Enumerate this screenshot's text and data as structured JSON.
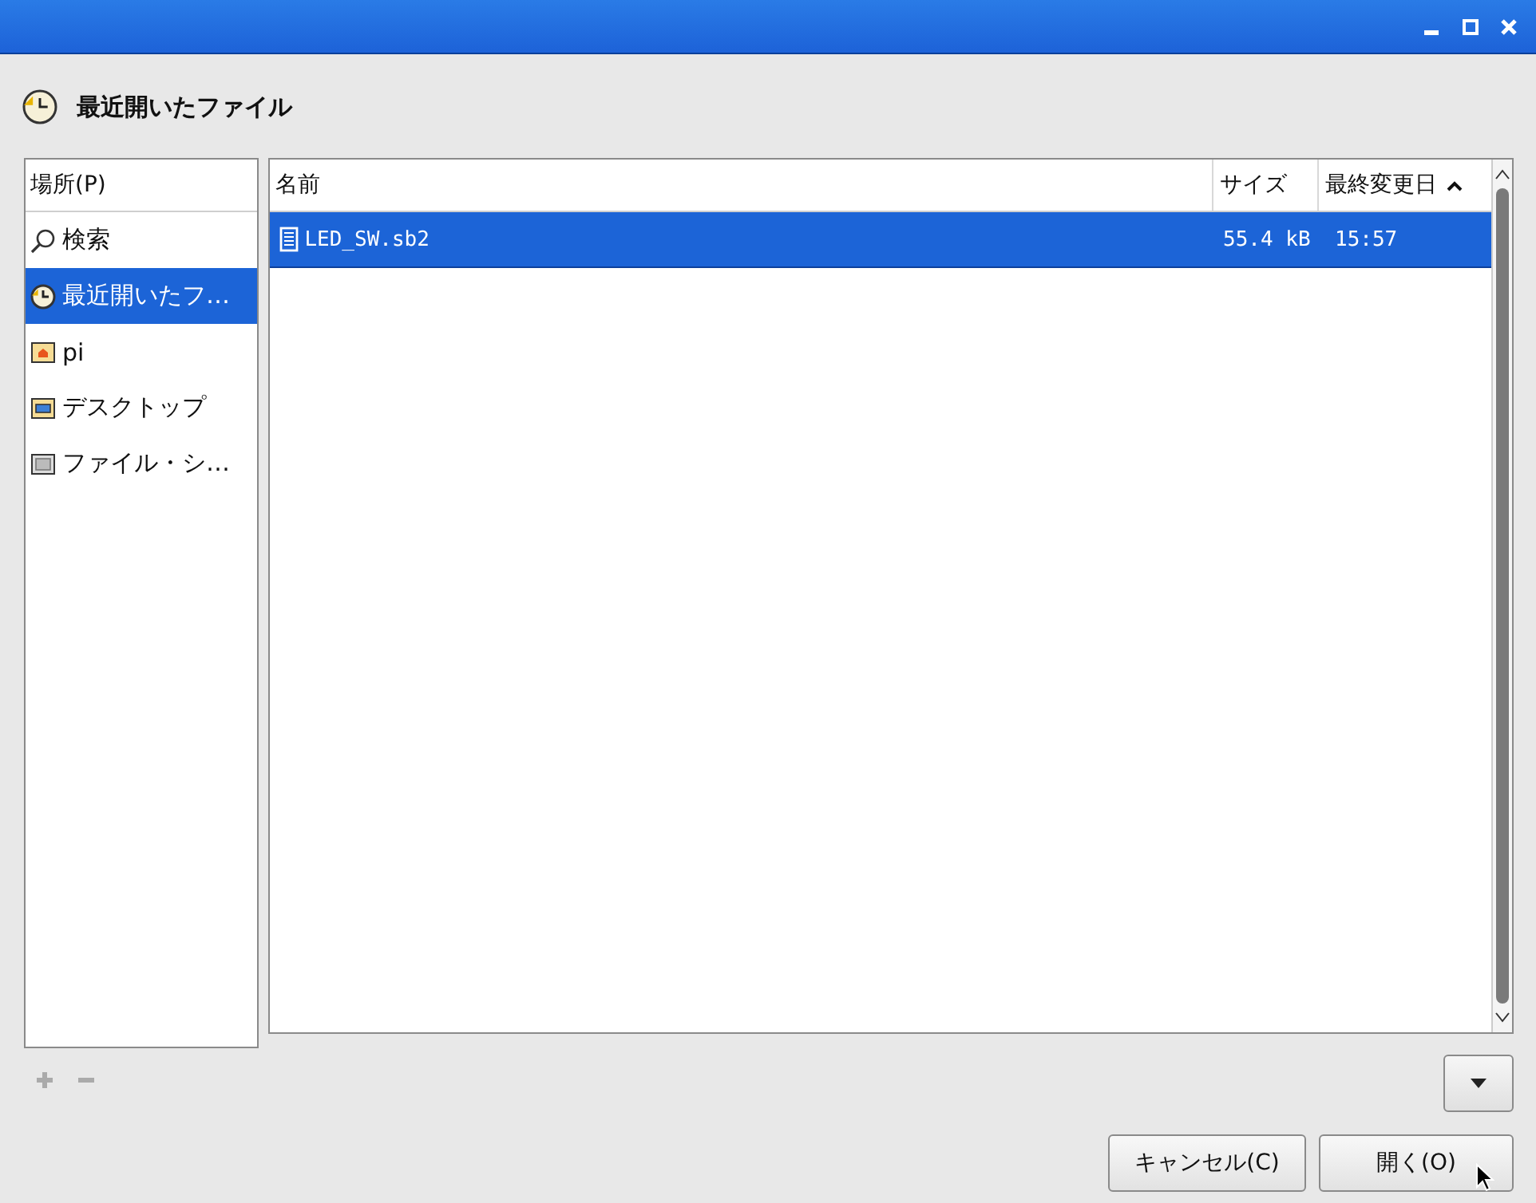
{
  "location": {
    "title": "最近開いたファイル"
  },
  "places": {
    "header": "場所(P)",
    "items": [
      {
        "kind": "search",
        "label": "検索",
        "selected": false
      },
      {
        "kind": "recent",
        "label": "最近開いたフ…",
        "selected": true
      },
      {
        "kind": "home",
        "label": "pi",
        "selected": false
      },
      {
        "kind": "desktop",
        "label": "デスクトップ",
        "selected": false
      },
      {
        "kind": "drive",
        "label": "ファイル・シ…",
        "selected": false
      }
    ]
  },
  "files": {
    "columns": [
      {
        "label": "名前",
        "sorted": false
      },
      {
        "label": "サイズ",
        "sorted": false
      },
      {
        "label": "最終変更日",
        "sorted": true
      }
    ],
    "rows": [
      {
        "name": "LED_SW.sb2",
        "size": "55.4 kB",
        "modified": "15:57",
        "selected": true
      }
    ]
  },
  "buttons": [
    {
      "kind": "cancel",
      "label": "キャンセル(C)"
    },
    {
      "kind": "open",
      "label": "開く(O)"
    }
  ]
}
